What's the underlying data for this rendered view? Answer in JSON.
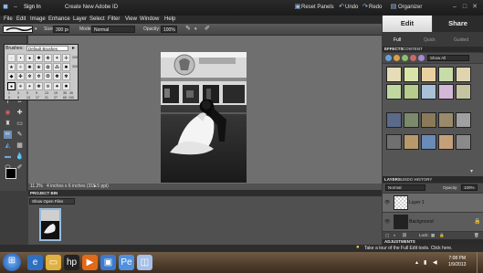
{
  "titlebar": {
    "sign_in": "Sign In",
    "create_id": "Create New Adobe ID",
    "reset_panels": "Reset Panels",
    "undo": "Undo",
    "redo": "Redo",
    "organizer": "Organizer"
  },
  "menu": [
    "File",
    "Edit",
    "Image",
    "Enhance",
    "Layer",
    "Select",
    "Filter",
    "View",
    "Window",
    "Help"
  ],
  "options": {
    "size_label": "Size:",
    "size_value": "300 px",
    "mode_label": "Mode:",
    "mode_value": "Normal",
    "opacity_label": "Opacity:",
    "opacity_value": "100%"
  },
  "brush_picker": {
    "label": "Brushes:",
    "set": "Default Brushes",
    "sizes": [
      "1",
      "3",
      "5",
      "9",
      "13",
      "19",
      "5",
      "9",
      "13",
      "17",
      "21",
      "27",
      "35",
      "45",
      "65",
      "100",
      "200",
      "300"
    ]
  },
  "status": {
    "zoom": "11.2%",
    "doc_info": "4 inches x 6 inches (315.5 ppi)"
  },
  "project_bin": {
    "title": "PROJECT BIN",
    "show": "Show Open Files"
  },
  "right_panel": {
    "tabs": [
      "Edit",
      "Share"
    ],
    "subtabs": [
      "Full",
      "Quick",
      "Guided"
    ],
    "effects_tabs": [
      "EFFECTS",
      "CONTENT"
    ],
    "effects_filter": "Show All",
    "layers_tabs": [
      "LAYERS",
      "UNDO HISTORY"
    ],
    "blend_mode": "Normal",
    "opacity_label": "Opacity:",
    "opacity_value": "100%",
    "lock_label": "Lock:",
    "layers": [
      "Layer 1",
      "Background"
    ],
    "adjustments": "ADJUSTMENTS"
  },
  "hint": "Take a tour of the Full Edit tools. Click here.",
  "taskbar": {
    "time": "7:08 PM",
    "date": "1/9/2013"
  },
  "colors": {
    "active_tab": "#e8e8e8",
    "share_tab": "#2b2b2b"
  }
}
